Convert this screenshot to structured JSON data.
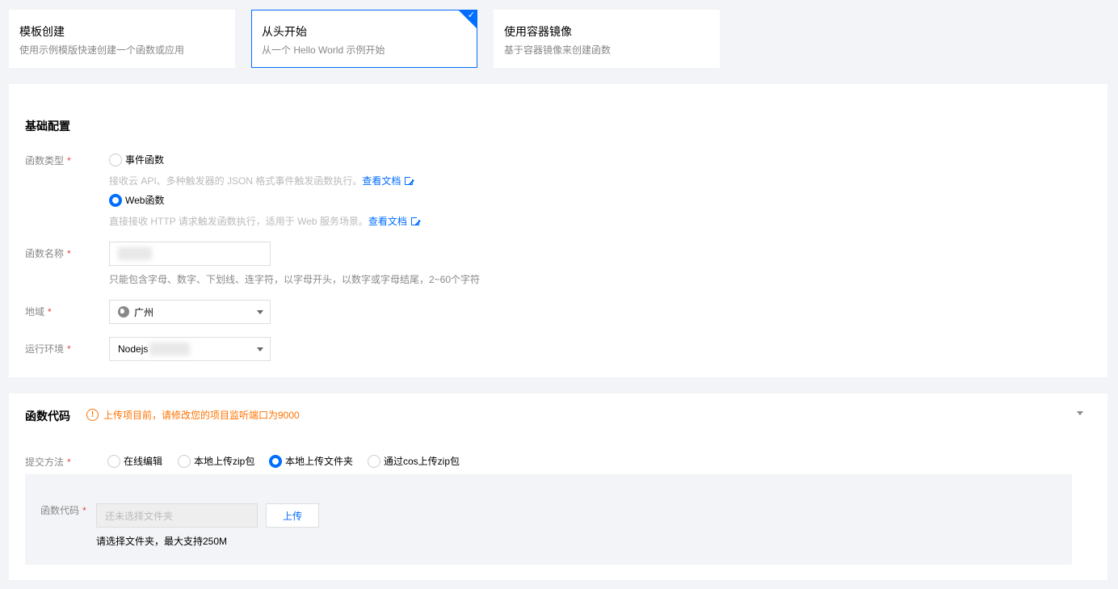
{
  "templates": [
    {
      "title": "模板创建",
      "desc": "使用示例模版快速创建一个函数或应用"
    },
    {
      "title": "从头开始",
      "desc": "从一个 Hello World 示例开始"
    },
    {
      "title": "使用容器镜像",
      "desc": "基于容器镜像来创建函数"
    }
  ],
  "basic": {
    "title": "基础配置",
    "func_type_label": "函数类型",
    "event_func": "事件函数",
    "event_hint": "接收云 API、多种触发器的 JSON 格式事件触发函数执行。",
    "web_func": "Web函数",
    "web_hint": "直接接收 HTTP 请求触发函数执行，适用于 Web 服务场景。",
    "doc_link": "查看文档",
    "name_label": "函数名称",
    "name_hint": "只能包含字母、数字、下划线、连字符，以字母开头，以数字或字母结尾，2~60个字符",
    "region_label": "地域",
    "region_value": "广州",
    "runtime_label": "运行环境",
    "runtime_value": "Nodejs"
  },
  "code": {
    "title": "函数代码",
    "warning": "上传项目前，请修改您的项目监听端口为9000",
    "submit_label": "提交方法",
    "methods": [
      "在线编辑",
      "本地上传zip包",
      "本地上传文件夹",
      "通过cos上传zip包"
    ],
    "code_label": "函数代码",
    "file_placeholder": "还未选择文件夹",
    "upload_btn": "上传",
    "upload_tip": "请选择文件夹，最大支持250M"
  },
  "colors": {
    "accent": "#006eff",
    "warning": "#ff7200",
    "required": "#e54545"
  }
}
